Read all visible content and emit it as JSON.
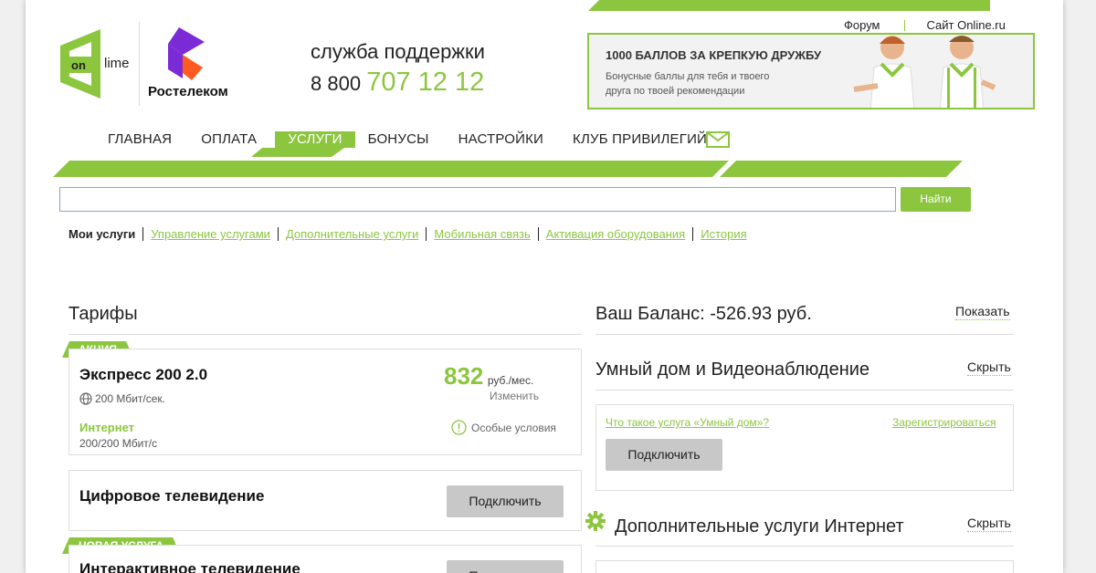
{
  "top_links": [
    "Форум",
    "Сайт Online.ru"
  ],
  "logo": {
    "online_on": "on",
    "online_lime": "lime",
    "rt_name": "Ростелеком"
  },
  "support": {
    "label": "служба поддержки",
    "prefix": "8 800",
    "number": "707 12 12"
  },
  "banner": {
    "title": "1000 БАЛЛОВ ЗА КРЕПКУЮ ДРУЖБУ",
    "text": "Бонусные баллы для тебя и твоего друга по твоей рекомендации"
  },
  "nav": [
    "ГЛАВНАЯ",
    "ОПЛАТА",
    "УСЛУГИ",
    "БОНУСЫ",
    "НАСТРОЙКИ",
    "КЛУБ ПРИВИЛЕГИЙ"
  ],
  "nav_active": "УСЛУГИ",
  "search": {
    "value": "",
    "button": "Найти"
  },
  "subnav": {
    "current": "Мои услуги",
    "links": [
      "Управление услугами",
      "Дополнительные услуги",
      "Мобильная связь",
      "Активация оборудования",
      "История"
    ]
  },
  "tariffs": {
    "heading": "Тарифы",
    "card1": {
      "tag": "АКЦИЯ",
      "title": "Экспресс 200 2.0",
      "speed": "200 Мбит/сек.",
      "price": "832",
      "price_unit": "руб./мес.",
      "change": "Изменить",
      "service": "Интернет",
      "service_speed": "200/200 Мбит/с",
      "special": "Особые условия"
    },
    "card2": {
      "title": "Цифровое телевидение",
      "button": "Подключить"
    },
    "card3": {
      "tag": "НОВАЯ УСЛУГА",
      "title": "Интерактивное телевидение",
      "button": "Подключить"
    }
  },
  "right": {
    "balance_label": "Ваш Баланс: -526.93 руб.",
    "balance_action": "Показать",
    "smart_home": {
      "heading": "Умный дом и Видеонаблюдение",
      "action": "Скрыть",
      "what_link": "Что такое услуга «Умный дом»?",
      "register": "Зарегистрироваться",
      "button": "Подключить"
    },
    "extra": {
      "heading": "Дополнительные услуги Интернет",
      "action": "Скрыть"
    }
  },
  "colors": {
    "accent": "#8cc63f",
    "rt_purple": "#7b2bd6",
    "rt_orange": "#ff5a1f"
  }
}
